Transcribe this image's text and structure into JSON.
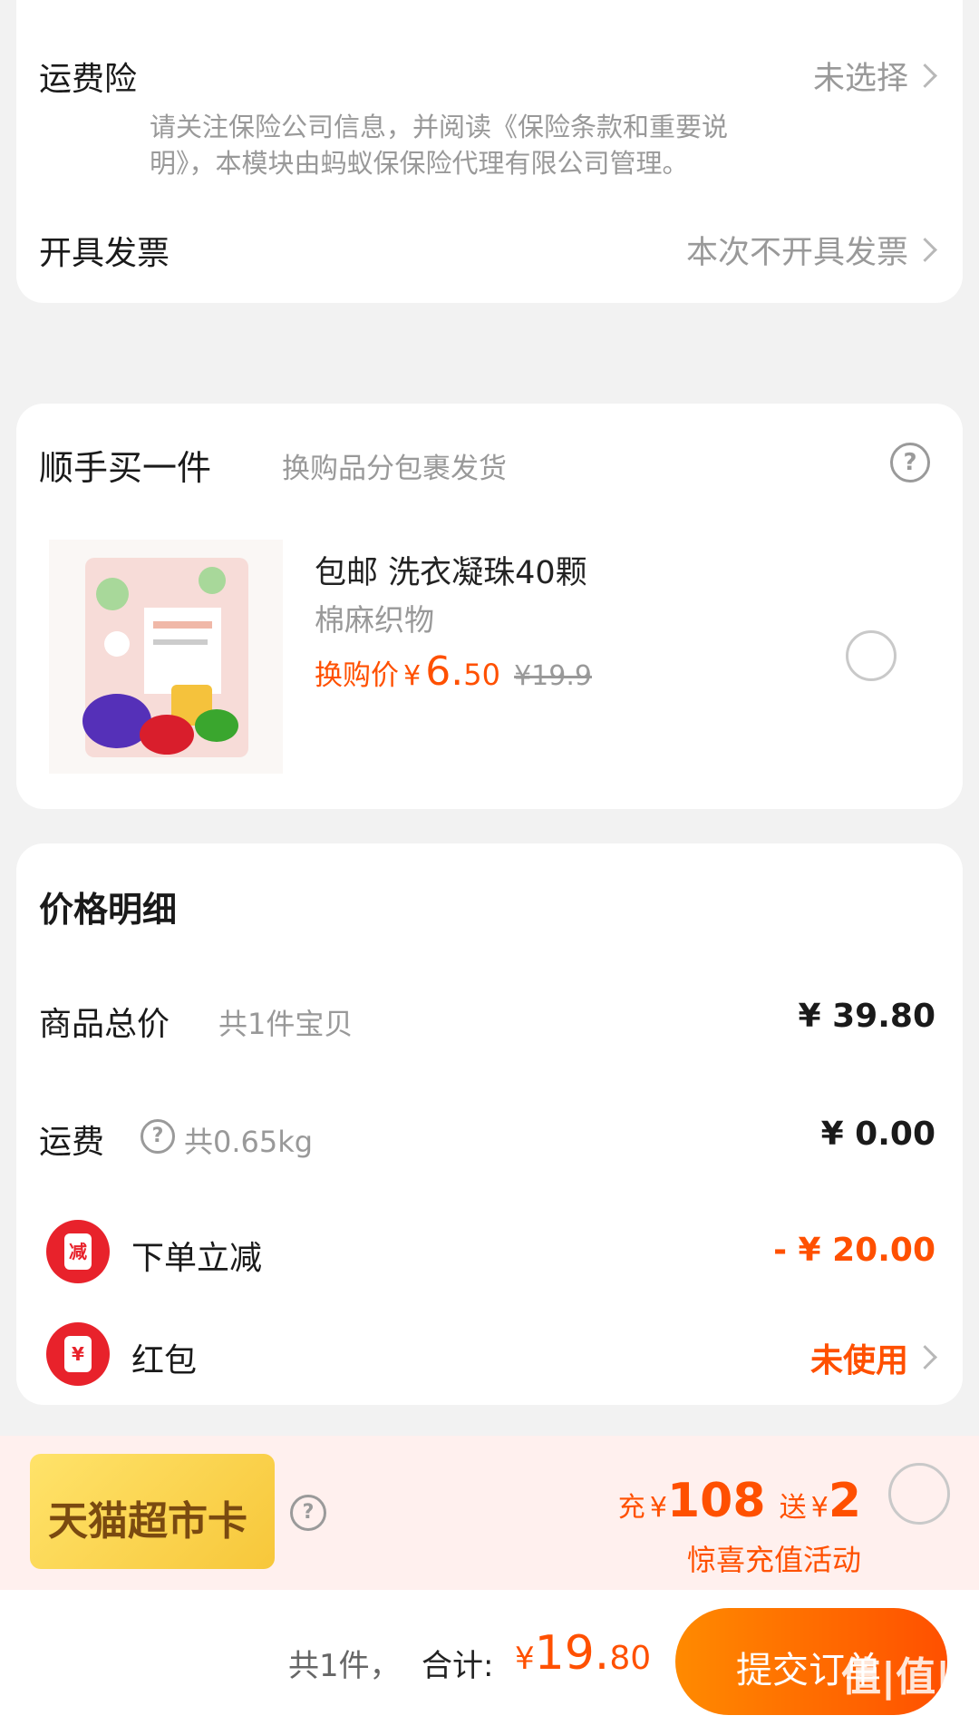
{
  "insurance": {
    "label": "运费险",
    "value": "未选择",
    "notice_line1": "请关注保险公司信息，并阅读《保险条款和重要说",
    "notice_line2": "明》，本模块由蚂蚁保保险代理有限公司管理。"
  },
  "invoice": {
    "label": "开具发票",
    "value": "本次不开具发票"
  },
  "addon": {
    "title": "顺手买一件",
    "subtitle": "换购品分包裹发货",
    "help_icon": "question-icon",
    "product": {
      "name": "包邮 洗衣凝珠40颗",
      "spec": "棉麻织物",
      "price_label": "换购价",
      "currency": "¥",
      "price_int": "6.",
      "price_dec": "50",
      "original_price": "¥19.9"
    }
  },
  "price_detail": {
    "title": "价格明细",
    "rows": {
      "goods": {
        "label": "商品总价",
        "sub": "共1件宝贝",
        "value": "¥ 39.80"
      },
      "shipping": {
        "label": "运费",
        "sub": "共0.65kg",
        "value": "¥ 0.00"
      },
      "discount": {
        "label": "下单立减",
        "badge": "减",
        "value": "- ¥ 20.00"
      },
      "redpacket": {
        "label": "红包",
        "badge": "¥",
        "value": "未使用"
      }
    }
  },
  "tmall_card": {
    "name": "天猫超市卡",
    "charge_label": "充",
    "currency": "¥",
    "charge_amount": "108",
    "gift_label": "送",
    "gift_amount": "2",
    "activity": "惊喜充值活动"
  },
  "footer": {
    "count": "共1件，",
    "total_label": "合计:",
    "currency": "¥",
    "total_int": "19.",
    "total_dec": "80",
    "submit": "提交订单"
  },
  "watermark": "值|值|值",
  "colors": {
    "accent": "#ff5000",
    "badge_red": "#e8222b",
    "gold": "#ffd24a"
  }
}
